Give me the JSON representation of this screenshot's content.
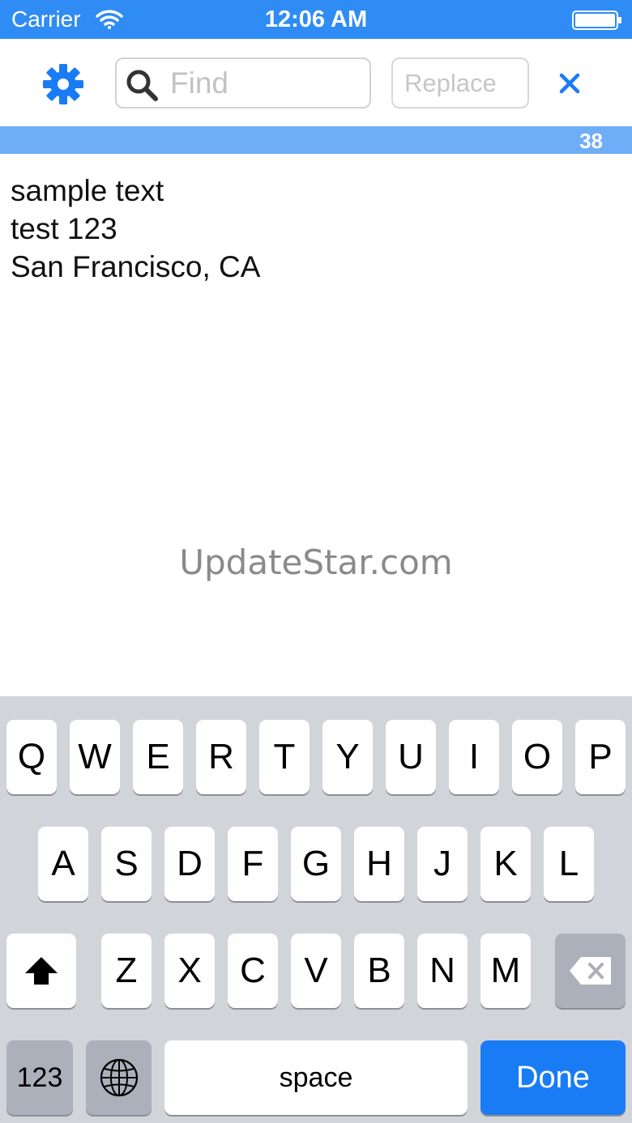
{
  "status_bar": {
    "carrier": "Carrier",
    "time": "12:06 AM",
    "icons": [
      "wifi-icon",
      "battery-icon"
    ]
  },
  "toolbar": {
    "settings_icon": "gear-icon",
    "find": {
      "icon": "search-icon",
      "placeholder": "Find",
      "value": ""
    },
    "replace": {
      "placeholder": "Replace",
      "value": ""
    },
    "close_icon": "close-icon"
  },
  "count_bar": {
    "count": "38"
  },
  "editor": {
    "lines": [
      "sample text",
      "test 123",
      "San Francisco, CA"
    ]
  },
  "watermark": "UpdateStar.com",
  "keyboard": {
    "row1": [
      "Q",
      "W",
      "E",
      "R",
      "T",
      "Y",
      "U",
      "I",
      "O",
      "P"
    ],
    "row2": [
      "A",
      "S",
      "D",
      "F",
      "G",
      "H",
      "J",
      "K",
      "L"
    ],
    "row3": [
      "Z",
      "X",
      "C",
      "V",
      "B",
      "N",
      "M"
    ],
    "numbers_label": "123",
    "space_label": "space",
    "done_label": "Done",
    "special_icons": [
      "shift-icon",
      "backspace-icon",
      "globe-icon"
    ]
  },
  "colors": {
    "accent": "#2f8cf4",
    "count_bar": "#6eadf8",
    "done_key": "#1a7cf5",
    "keyboard_bg": "#d1d4d9"
  }
}
